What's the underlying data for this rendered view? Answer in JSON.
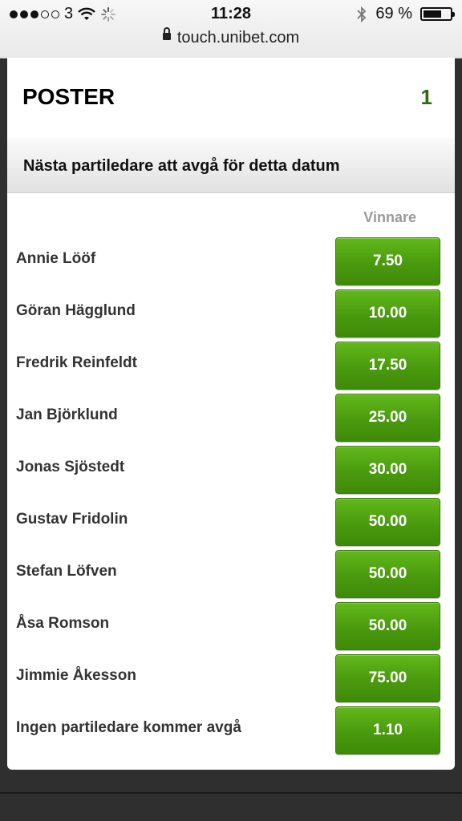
{
  "status_bar": {
    "carrier": "3",
    "time": "11:28",
    "battery_percent": "69 %",
    "battery_level": 0.69,
    "url": "touch.unibet.com",
    "icons": [
      "signal-dots-icon",
      "wifi-icon",
      "loading-spinner-icon",
      "bluetooth-icon",
      "battery-icon",
      "lock-icon"
    ]
  },
  "header": {
    "title": "POSTER",
    "count": "1"
  },
  "market": {
    "title": "Nästa partiledare att avgå för detta datum",
    "column_label": "Vinnare",
    "selections": [
      {
        "name": "Annie Lööf",
        "odds": "7.50"
      },
      {
        "name": "Göran Hägglund",
        "odds": "10.00"
      },
      {
        "name": "Fredrik Reinfeldt",
        "odds": "17.50"
      },
      {
        "name": "Jan Björklund",
        "odds": "25.00"
      },
      {
        "name": "Jonas Sjöstedt",
        "odds": "30.00"
      },
      {
        "name": "Gustav Fridolin",
        "odds": "50.00"
      },
      {
        "name": "Stefan Löfven",
        "odds": "50.00"
      },
      {
        "name": "Åsa Romson",
        "odds": "50.00"
      },
      {
        "name": "Jimmie Åkesson",
        "odds": "75.00"
      },
      {
        "name": "Ingen partiledare kommer avgå",
        "odds": "1.10"
      }
    ]
  },
  "colors": {
    "odds_green": "#4a9a0e",
    "count_green": "#2f6b0a",
    "page_background": "#2f2f2f"
  }
}
